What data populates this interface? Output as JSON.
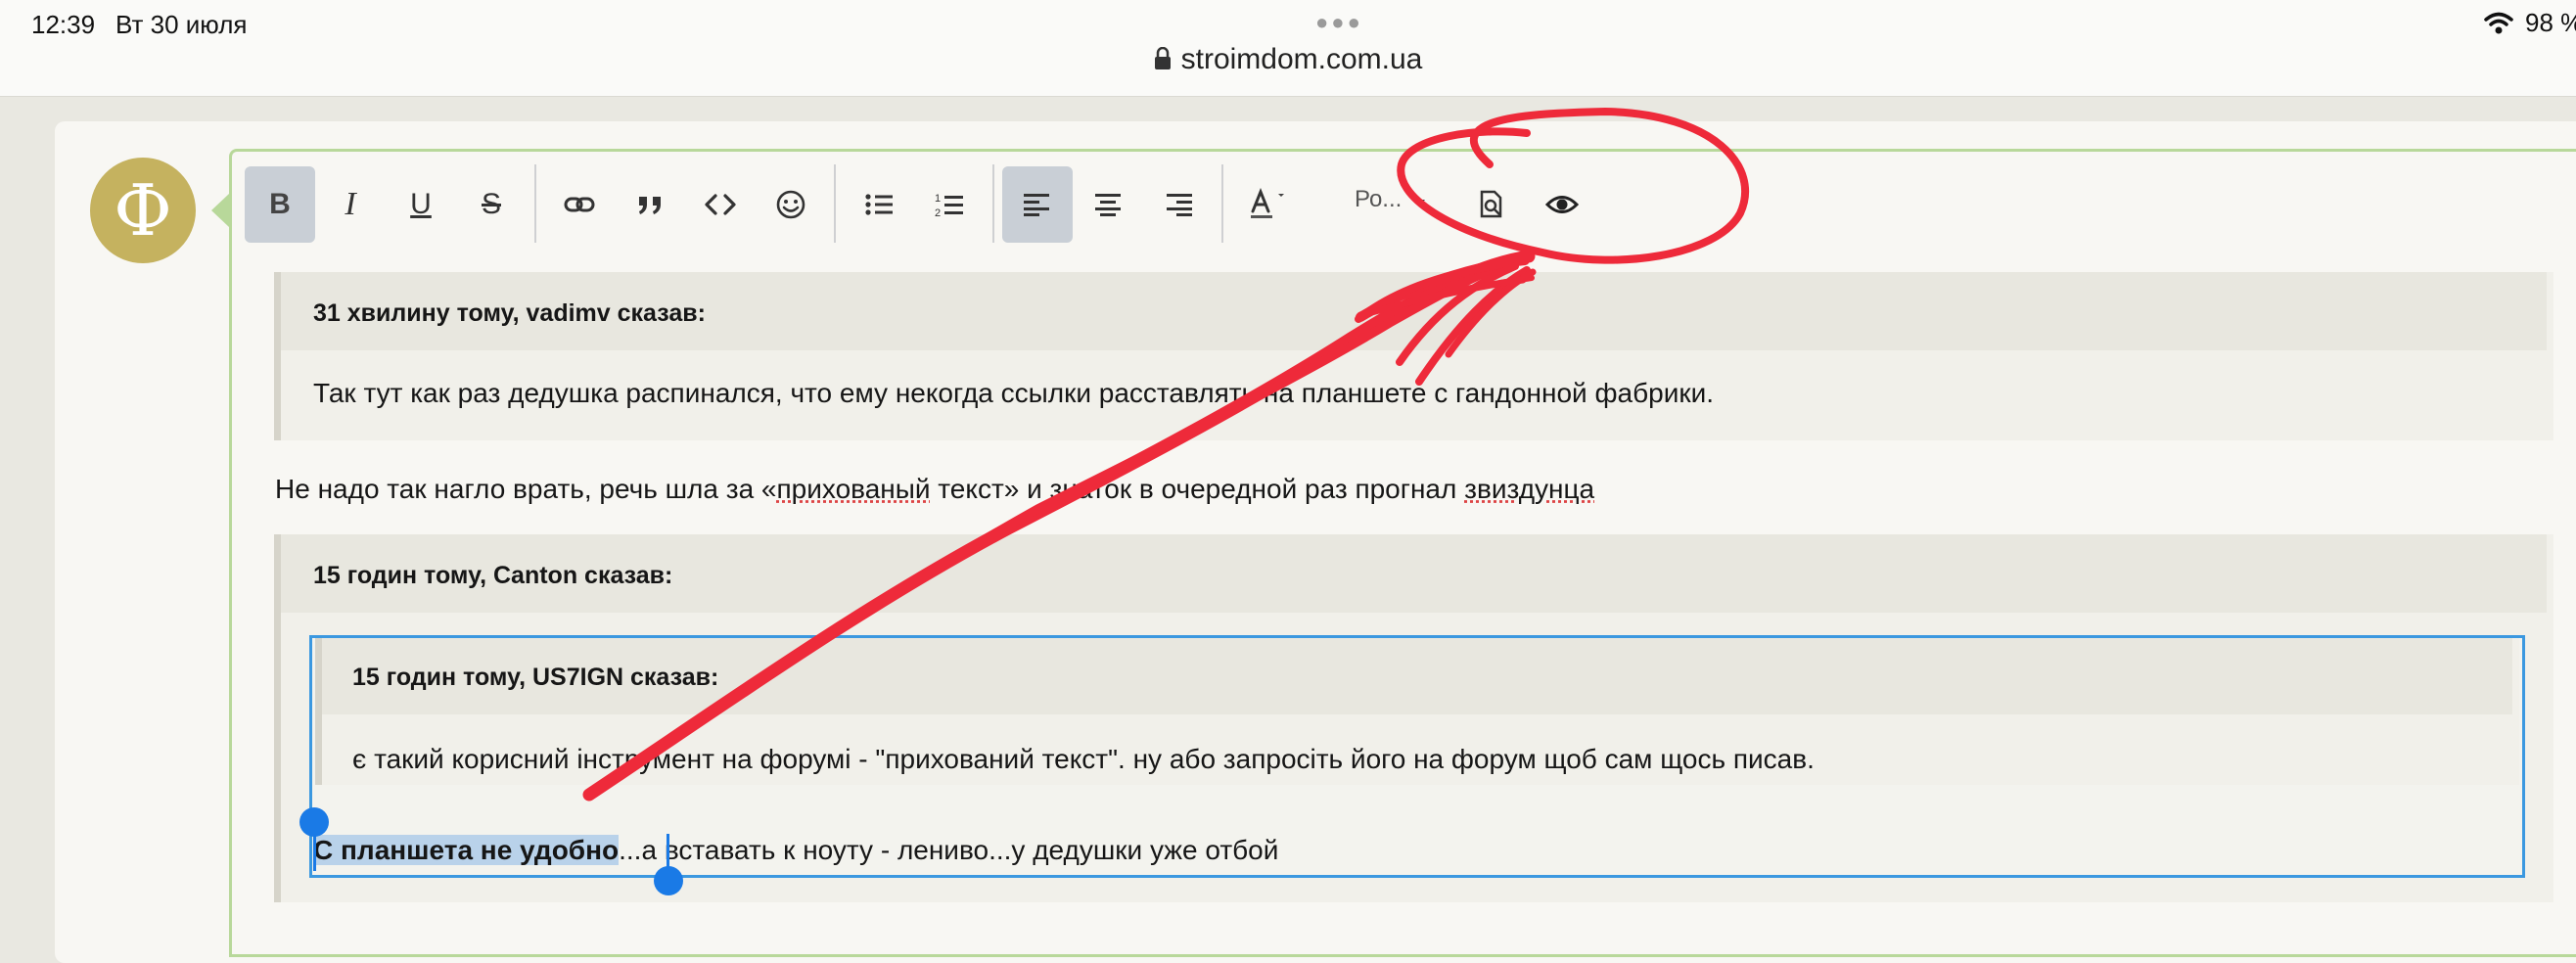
{
  "status_bar": {
    "time": "12:39",
    "date": "Вт 30 июля",
    "url": "stroimdom.com.ua",
    "battery": "98 %"
  },
  "avatar_letter": "Ф",
  "toolbar": {
    "bold": "B",
    "italic": "I",
    "underline": "U",
    "strike": "S",
    "font_size": "Ро..."
  },
  "content": {
    "quote1": {
      "header": "31 хвилину тому, vadimv сказав:",
      "body": "Так тут как раз дедушка распинался, что ему некогда ссылки расставлять на планшете с гандонной фабрики."
    },
    "paragraph1": {
      "part1": "Не надо так нагло врать, речь шла за «",
      "part2": "прихованый",
      "part3": " текст» и знаток в очередной раз прогнал ",
      "part4": "звиздунца"
    },
    "quote2": {
      "header": "15 годин тому, Canton сказав:",
      "nested": {
        "header": "15 годин тому, US7IGN сказав:",
        "body": "є такий корисний інструмент на форумі - \"прихований текст\". ну або запросіть його на форум щоб сам щось писав."
      },
      "selected_text": "С планшета не удобно",
      "rest_text": "...а вставать к ноуту - лениво...у дедушки уже отбой"
    }
  },
  "colors": {
    "annotation": "#ee2a3a",
    "selection": "#3b98e0",
    "avatar_bg": "#c5b25f",
    "editor_border": "#b8d89a"
  }
}
